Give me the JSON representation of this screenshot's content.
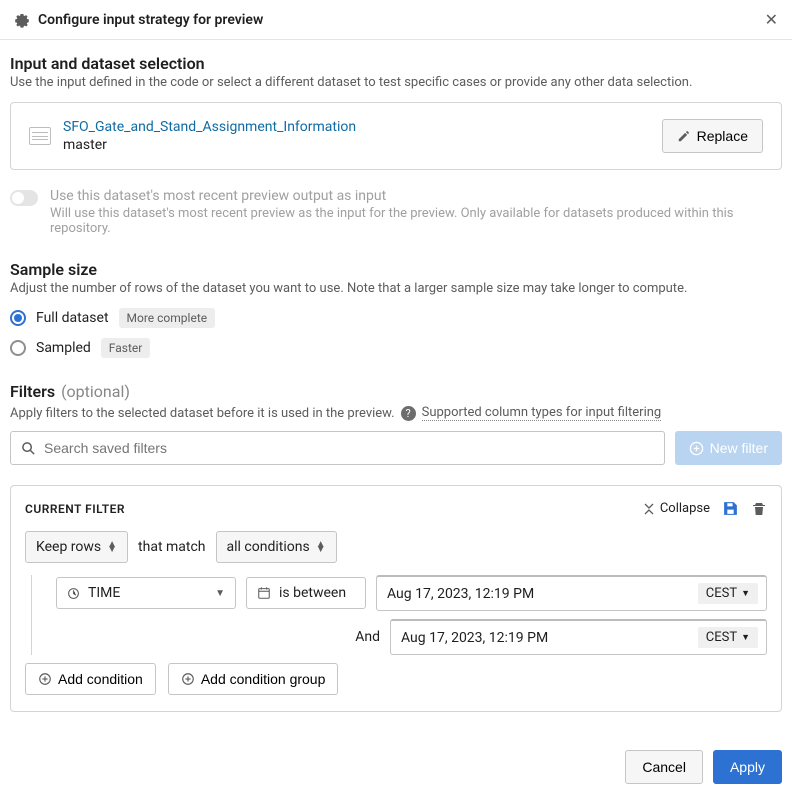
{
  "dialog": {
    "title": "Configure input strategy for preview"
  },
  "input_section": {
    "heading": "Input and dataset selection",
    "desc": "Use the input defined in the code or select a different dataset to test specific cases or provide any other data selection.",
    "dataset_name": "SFO_Gate_and_Stand_Assignment_Information",
    "branch": "master",
    "replace_label": "Replace",
    "toggle_title": "Use this dataset's most recent preview output as input",
    "toggle_desc": "Will use this dataset's most recent preview as the input for the preview. Only available for datasets produced within this repository."
  },
  "sample": {
    "heading": "Sample size",
    "desc": "Adjust the number of rows of the dataset you want to use. Note that a larger sample size may take longer to compute.",
    "full_label": "Full dataset",
    "full_badge": "More complete",
    "sampled_label": "Sampled",
    "sampled_badge": "Faster"
  },
  "filters": {
    "heading": "Filters",
    "optional": "(optional)",
    "desc_prefix": "Apply filters to the selected dataset before it is used in the preview.",
    "help_link": "Supported column types for input filtering",
    "search_placeholder": "Search saved filters",
    "new_filter_label": "New filter"
  },
  "current_filter": {
    "title": "CURRENT FILTER",
    "collapse_label": "Collapse",
    "action_label": "Keep rows",
    "match_text": "that match",
    "combine_label": "all conditions",
    "column": "TIME",
    "operator": "is between",
    "value1": "Aug 17, 2023, 12:19 PM",
    "tz1": "CEST",
    "and_label": "And",
    "value2": "Aug 17, 2023, 12:19 PM",
    "tz2": "CEST",
    "add_condition": "Add condition",
    "add_group": "Add condition group"
  },
  "footer": {
    "cancel": "Cancel",
    "apply": "Apply"
  }
}
